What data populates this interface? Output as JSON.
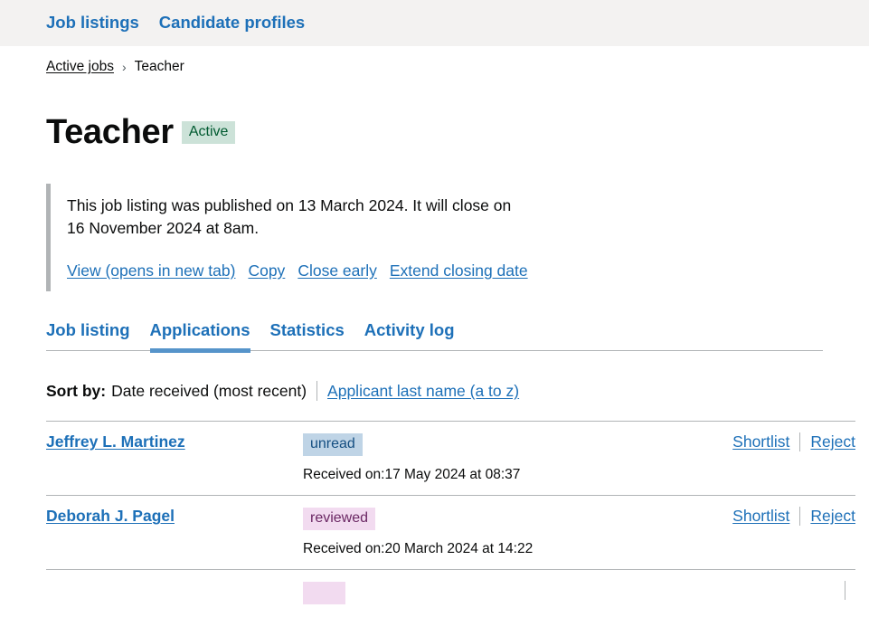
{
  "topnav": {
    "items": [
      {
        "label": "Job listings"
      },
      {
        "label": "Candidate profiles"
      }
    ]
  },
  "breadcrumb": {
    "items": [
      {
        "label": "Active jobs",
        "link": true
      },
      {
        "label": "Teacher",
        "link": false
      }
    ],
    "separator": "›"
  },
  "page": {
    "title": "Teacher",
    "status_tag": "Active",
    "status_tag_bg": "#cce2d8",
    "status_tag_color": "#005a30"
  },
  "inset": {
    "text": "This job listing was published on 13 March 2024. It will close on 16 November 2024 at 8am.",
    "links": [
      {
        "label": "View (opens in new tab)"
      },
      {
        "label": "Copy"
      },
      {
        "label": "Close early"
      },
      {
        "label": "Extend closing date"
      }
    ]
  },
  "tabs": [
    {
      "label": "Job listing",
      "active": false
    },
    {
      "label": "Applications",
      "active": true
    },
    {
      "label": "Statistics",
      "active": false
    },
    {
      "label": "Activity log",
      "active": false
    }
  ],
  "sort": {
    "label": "Sort by:",
    "current": "Date received (most recent)",
    "alternative": "Applicant last name (a to z)"
  },
  "applications": [
    {
      "name": "Jeffrey L. Martinez",
      "status": "unread",
      "status_style": "tag-blue",
      "received": "Received on:17 May 2024 at 08:37",
      "shortlist_label": "Shortlist",
      "reject_label": "Reject"
    },
    {
      "name": "Deborah J. Pagel",
      "status": "reviewed",
      "status_style": "tag-purple",
      "received": "Received on:20 March 2024 at 14:22",
      "shortlist_label": "Shortlist",
      "reject_label": "Reject"
    },
    {
      "name": "",
      "status": "",
      "status_style": "tag-purple",
      "received": "",
      "shortlist_label": "",
      "reject_label": ""
    }
  ],
  "colors": {
    "link": "#1d70b8",
    "header_bg": "#f3f2f1",
    "border": "#b1b4b6",
    "tab_active_bar": "#5694ca",
    "text": "#0b0c0c"
  }
}
